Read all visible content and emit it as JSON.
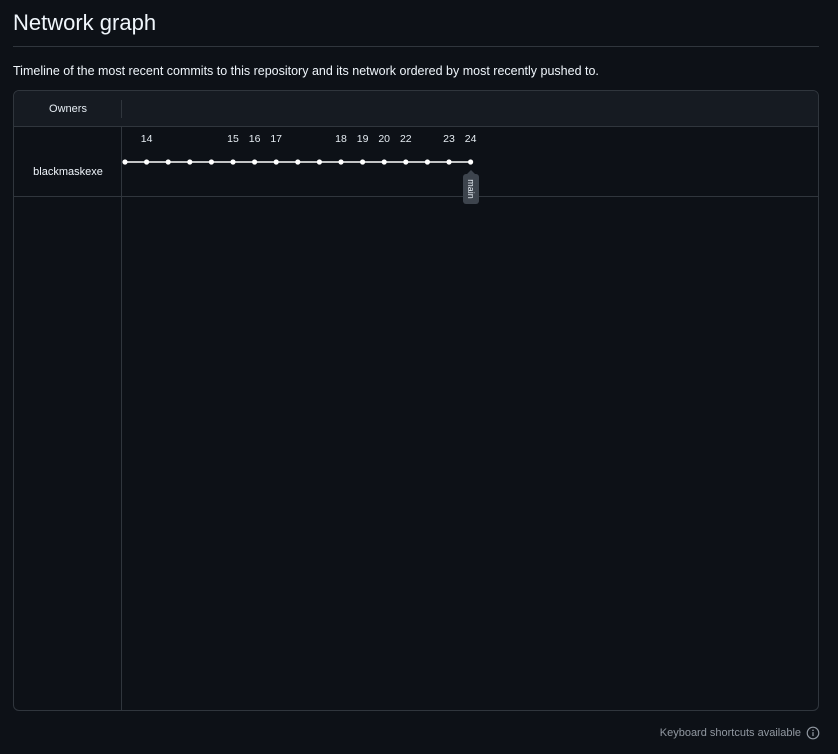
{
  "page": {
    "title": "Network graph",
    "description": "Timeline of the most recent commits to this repository and its network ordered by most recently pushed to."
  },
  "graph": {
    "owners_header": "Owners",
    "owner": "blackmaskexe",
    "branch": "main",
    "date_labels": [
      {
        "label": "14",
        "commit_index": 1
      },
      {
        "label": "15",
        "commit_index": 5
      },
      {
        "label": "16",
        "commit_index": 6
      },
      {
        "label": "17",
        "commit_index": 7
      },
      {
        "label": "18",
        "commit_index": 10
      },
      {
        "label": "19",
        "commit_index": 11
      },
      {
        "label": "20",
        "commit_index": 12
      },
      {
        "label": "22",
        "commit_index": 13
      },
      {
        "label": "23",
        "commit_index": 15
      },
      {
        "label": "24",
        "commit_index": 16
      }
    ],
    "commit_count": 17,
    "branch_head_commit_index": 16,
    "colors": {
      "line": "#ffffff",
      "dot": "#ffffff"
    }
  },
  "footer": {
    "shortcuts_text": "Keyboard shortcuts available",
    "icon": "info-icon"
  }
}
